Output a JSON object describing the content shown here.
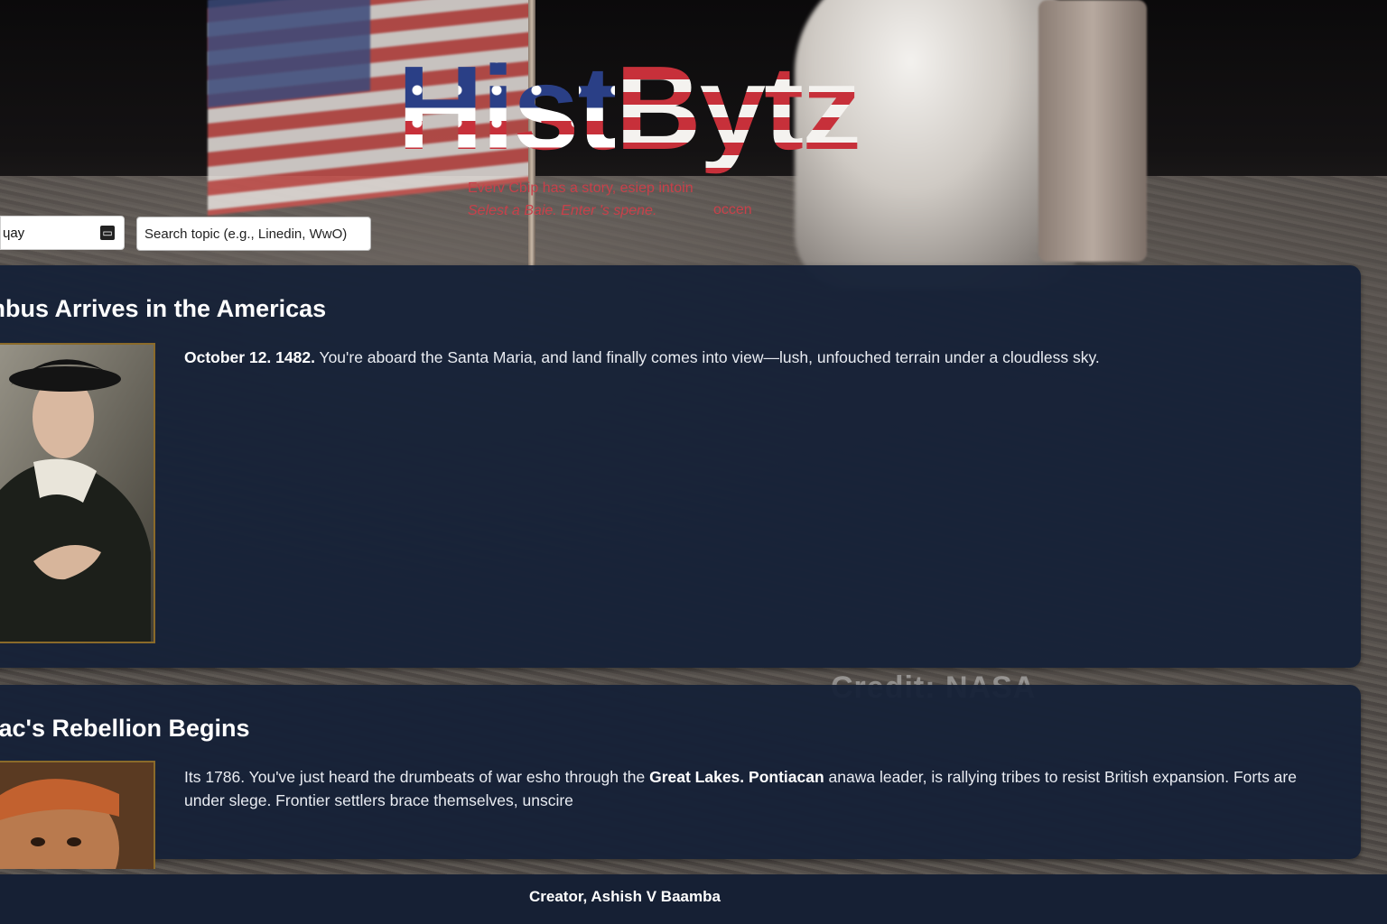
{
  "background": {
    "credit": "Credit: NASA"
  },
  "header": {
    "logo_part1": "Hist",
    "logo_part2": "Bytz",
    "tagline_line1": "Everv Cbip has a story, esiep intoin",
    "tagline_line2": "Selest a Baie. Enter 's spene.",
    "tagline_extra": "occen"
  },
  "search": {
    "date_value": "ɥay",
    "topic_placeholder": "Search topic (e.g., Linedin, WwO)"
  },
  "cards": [
    {
      "title": "mbus Arrives in the Americas",
      "date": "October 12. 1482.",
      "text": "You're aboard the Santa Maria, and land finally comes into view—lush, unfouched terrain under a cloudless sky."
    },
    {
      "title": "tiac's Rebellion Begins",
      "text_start": "Its 1786. You've just heard the drumbeats of war esho through the",
      "bold_1": "Great Lakes.",
      "bold_2": "Pontiacan",
      "text_end": "anawa leader, is rallying tribes to resist British expansion. Forts are under slege. Frontier settlers brace themselves, unscire"
    }
  ],
  "footer": {
    "text": "Creator, Ashish V Baamba"
  },
  "colors": {
    "card_bg": "#162137",
    "tagline": "#c8404a",
    "footer_bg": "#162034"
  }
}
